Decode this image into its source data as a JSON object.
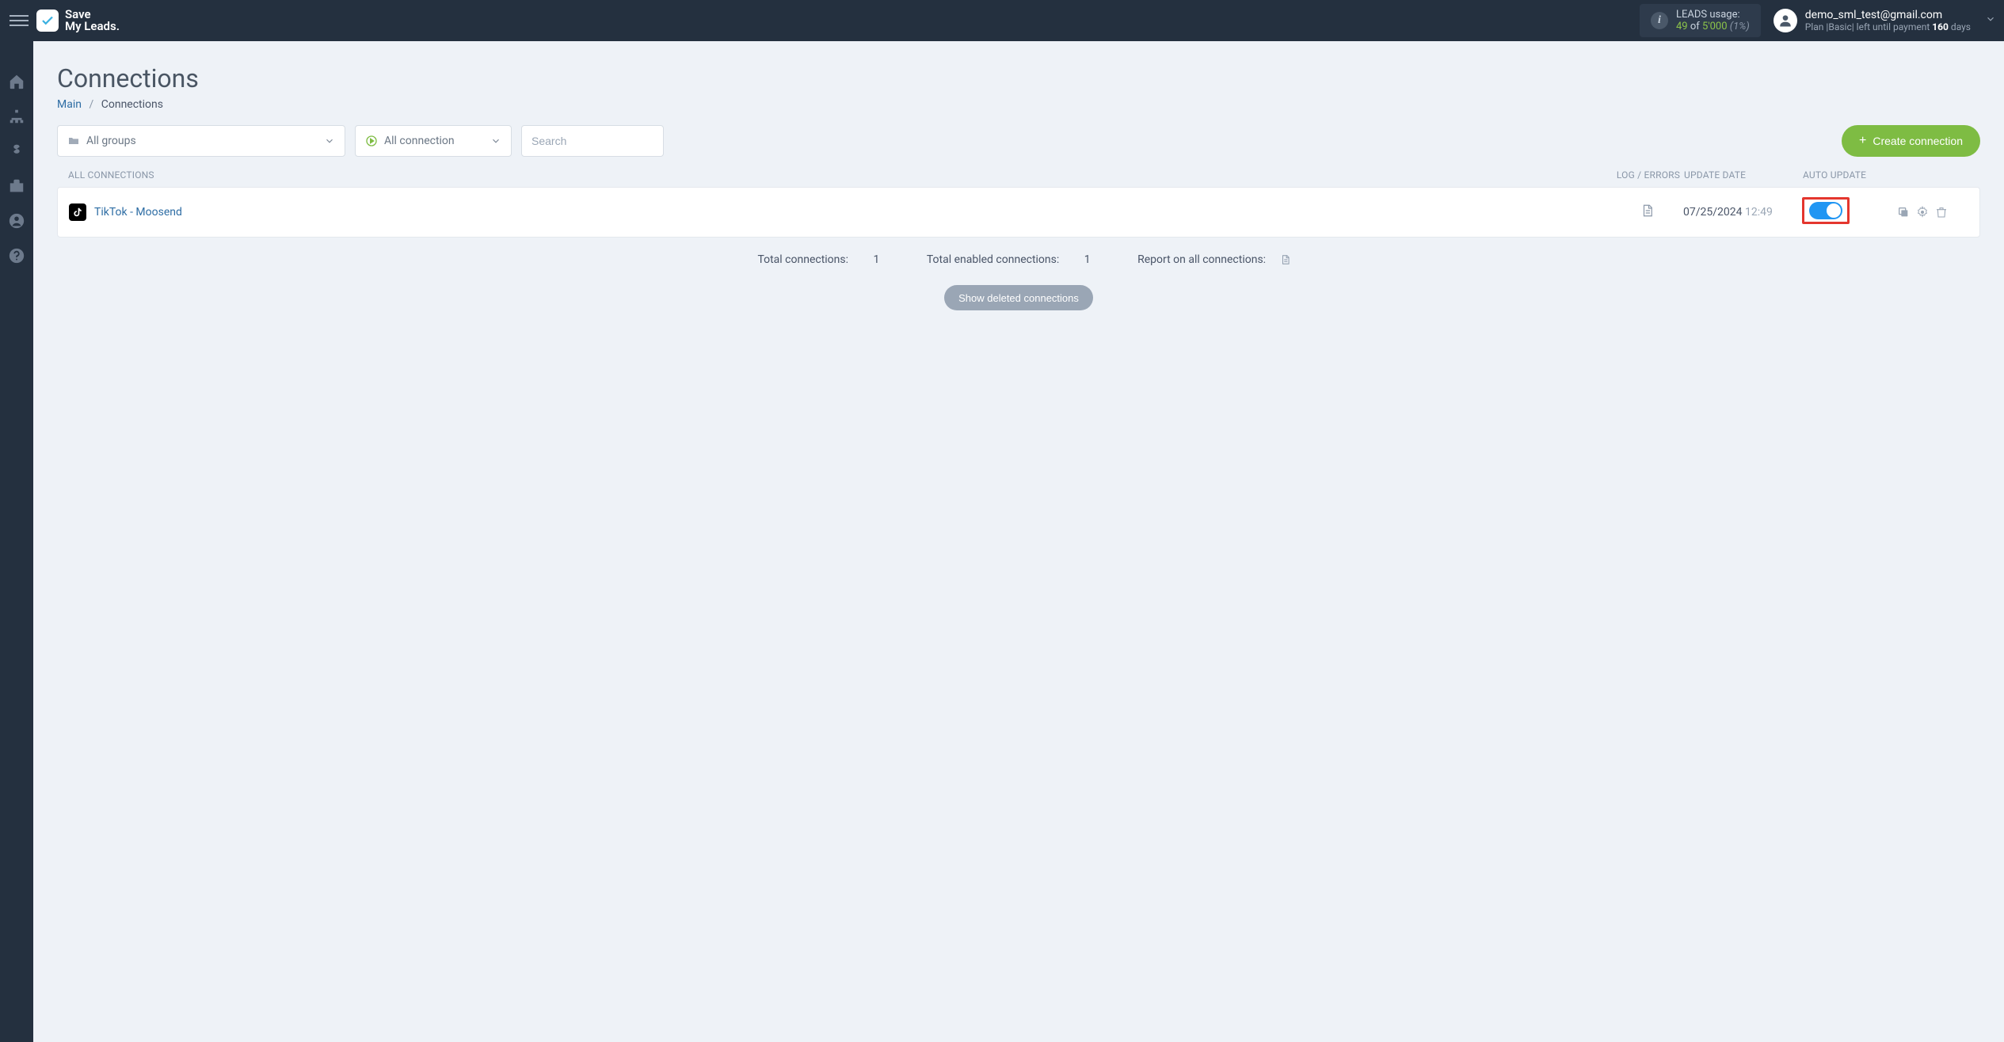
{
  "header": {
    "logo_line1": "Save",
    "logo_line2": "My Leads.",
    "leads_label": "LEADS usage:",
    "leads_used": "49",
    "leads_of": "of",
    "leads_total": "5'000",
    "leads_pct": "(1%)",
    "user_email": "demo_sml_test@gmail.com",
    "plan_prefix": "Plan |",
    "plan_name": "Basic",
    "plan_mid": "| left until payment",
    "plan_days": "160",
    "plan_suffix": "days"
  },
  "page": {
    "title": "Connections",
    "breadcrumb_main": "Main",
    "breadcrumb_current": "Connections"
  },
  "filters": {
    "groups_label": "All groups",
    "conn_label": "All connection",
    "search_placeholder": "Search",
    "create_label": "Create connection"
  },
  "table": {
    "head_name": "ALL CONNECTIONS",
    "head_log": "LOG / ERRORS",
    "head_date": "UPDATE DATE",
    "head_auto": "AUTO UPDATE",
    "row": {
      "name": "TikTok - Moosend",
      "date": "07/25/2024",
      "time": "12:49"
    }
  },
  "summary": {
    "total_label": "Total connections:",
    "total_value": "1",
    "enabled_label": "Total enabled connections:",
    "enabled_value": "1",
    "report_label": "Report on all connections:"
  },
  "buttons": {
    "show_deleted": "Show deleted connections"
  }
}
